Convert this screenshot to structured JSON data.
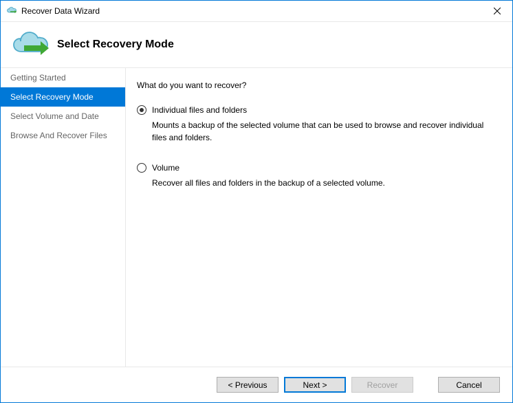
{
  "window": {
    "title": "Recover Data Wizard"
  },
  "header": {
    "page_title": "Select Recovery Mode"
  },
  "sidebar": {
    "items": [
      {
        "label": "Getting Started",
        "active": false
      },
      {
        "label": "Select Recovery Mode",
        "active": true
      },
      {
        "label": "Select Volume and Date",
        "active": false
      },
      {
        "label": "Browse And Recover Files",
        "active": false
      }
    ]
  },
  "main": {
    "question": "What do you want to recover?",
    "options": [
      {
        "label": "Individual files and folders",
        "description": "Mounts a backup of the selected volume that can be used to browse and recover individual files and folders.",
        "selected": true
      },
      {
        "label": "Volume",
        "description": "Recover all files and folders in the backup of a selected volume.",
        "selected": false
      }
    ]
  },
  "footer": {
    "previous": "< Previous",
    "next": "Next >",
    "recover": "Recover",
    "cancel": "Cancel"
  }
}
